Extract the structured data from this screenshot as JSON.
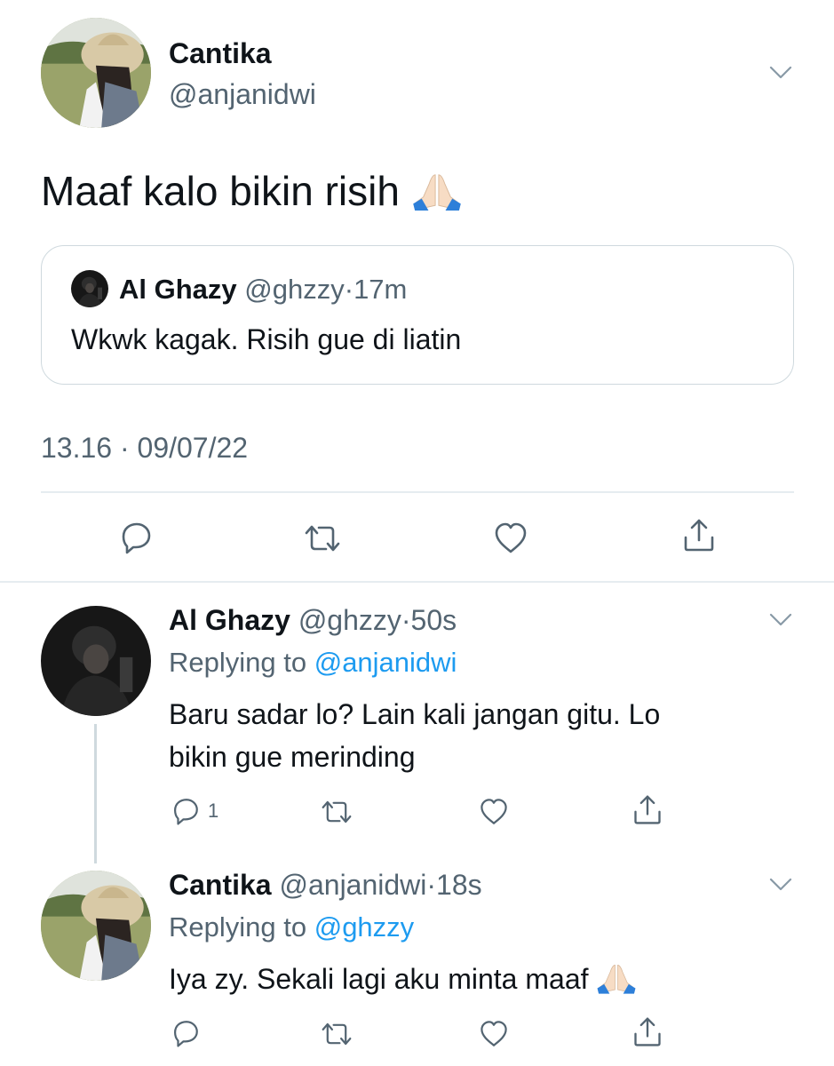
{
  "main_tweet": {
    "author_name": "Cantika",
    "author_handle": "@anjanidwi",
    "text": "Maaf kalo bikin risih",
    "emoji": "folded-hands",
    "quoted": {
      "author_name": "Al Ghazy",
      "author_handle": "@ghzzy",
      "separator": "·",
      "time": "17m",
      "text": "Wkwk kagak. Risih gue di liatin"
    },
    "timestamp": "13.16 · 09/07/22"
  },
  "replies": [
    {
      "author_name": "Al Ghazy",
      "author_handle": "@ghzzy",
      "separator": "·",
      "time": "50s",
      "replying_prefix": "Replying to",
      "replying_to": "@anjanidwi",
      "text_line1": "Baru sadar lo? Lain kali jangan gitu. Lo",
      "text_line2": "bikin gue merinding",
      "reply_count": "1"
    },
    {
      "author_name": "Cantika",
      "author_handle": "@anjanidwi",
      "separator": "·",
      "time": "18s",
      "replying_prefix": "Replying to",
      "replying_to": "@ghzzy",
      "text": "Iya zy. Sekali lagi aku minta maaf",
      "emoji": "folded-hands"
    }
  ],
  "icons": [
    "chevron-down-icon",
    "reply-icon",
    "retweet-icon",
    "like-icon",
    "share-icon"
  ],
  "colors": {
    "text": "#0f1419",
    "muted": "#536471",
    "link": "#1d9bf0",
    "border": "#cfd9de"
  }
}
